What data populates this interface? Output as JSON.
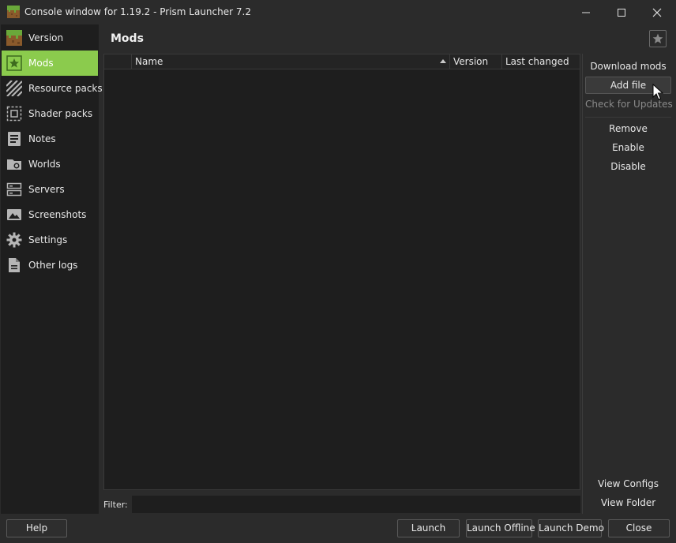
{
  "window": {
    "title": "Console window for 1.19.2 - Prism Launcher 7.2",
    "app_icon": "grass-block-icon",
    "controls": [
      "minimize-icon",
      "maximize-icon",
      "close-icon"
    ]
  },
  "sidebar": {
    "items": [
      {
        "label": "Version",
        "icon": "grass-block-icon",
        "active": false
      },
      {
        "label": "Mods",
        "icon": "star-icon",
        "active": true
      },
      {
        "label": "Resource packs",
        "icon": "hatched-icon",
        "active": false
      },
      {
        "label": "Shader packs",
        "icon": "shader-icon",
        "active": false
      },
      {
        "label": "Notes",
        "icon": "notes-icon",
        "active": false
      },
      {
        "label": "Worlds",
        "icon": "worlds-icon",
        "active": false
      },
      {
        "label": "Servers",
        "icon": "servers-icon",
        "active": false
      },
      {
        "label": "Screenshots",
        "icon": "image-icon",
        "active": false
      },
      {
        "label": "Settings",
        "icon": "gear-icon",
        "active": false
      },
      {
        "label": "Other logs",
        "icon": "document-icon",
        "active": false
      }
    ]
  },
  "main": {
    "title": "Mods",
    "table": {
      "columns": [
        "",
        "Name",
        "Version",
        "Last changed"
      ],
      "sort_column": "Name",
      "rows": []
    },
    "filter": {
      "label": "Filter:",
      "value": ""
    }
  },
  "actions": {
    "download_mods": "Download mods",
    "add_file": "Add file",
    "check_updates": "Check for Updates",
    "remove": "Remove",
    "enable": "Enable",
    "disable": "Disable",
    "view_configs": "View Configs",
    "view_folder": "View Folder"
  },
  "footer": {
    "help": "Help",
    "launch": "Launch",
    "launch_offline": "Launch Offline",
    "launch_demo": "Launch Demo",
    "close": "Close"
  },
  "colors": {
    "accent": "#8bcb4d",
    "background": "#2b2b2b",
    "panel": "#1e1e1e"
  }
}
